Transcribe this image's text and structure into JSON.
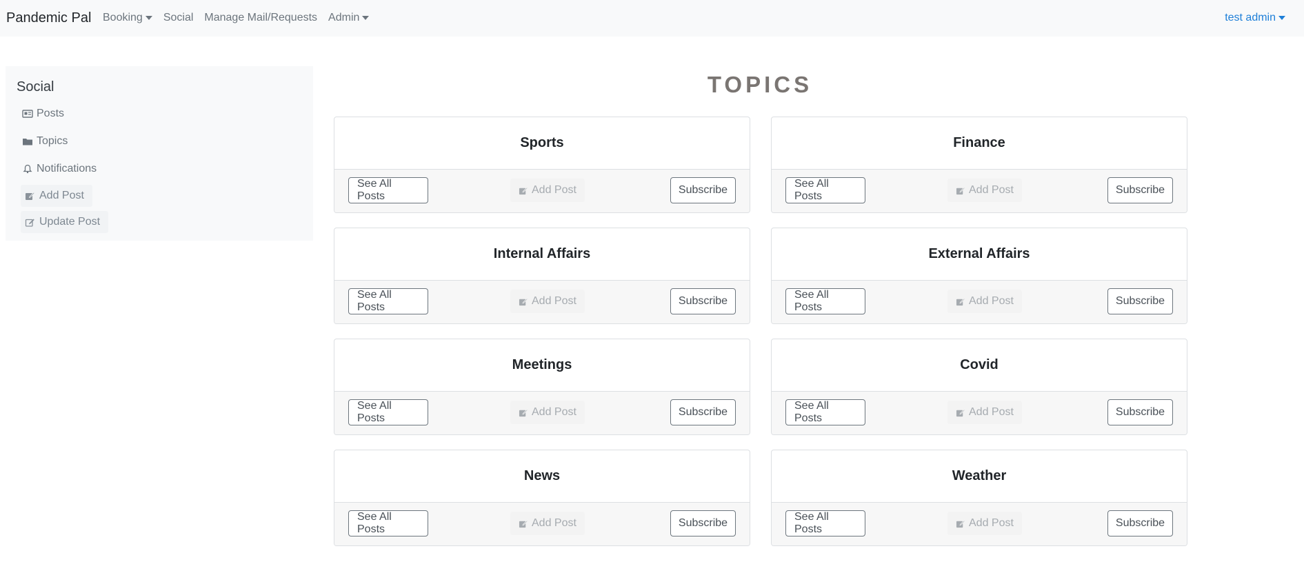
{
  "navbar": {
    "brand": "Pandemic Pal",
    "links": [
      {
        "label": "Booking",
        "dropdown": true
      },
      {
        "label": "Social",
        "dropdown": false
      },
      {
        "label": "Manage Mail/Requests",
        "dropdown": false
      },
      {
        "label": "Admin",
        "dropdown": true
      }
    ],
    "user": "test admin"
  },
  "sidebar": {
    "title": "Social",
    "items": [
      {
        "label": "Posts",
        "icon": "newspaper-icon"
      },
      {
        "label": "Topics",
        "icon": "folder-icon"
      },
      {
        "label": "Notifications",
        "icon": "bell-icon"
      }
    ],
    "actions": [
      {
        "label": "Add Post",
        "icon": "edit-icon"
      },
      {
        "label": "Update Post",
        "icon": "edit-icon"
      }
    ]
  },
  "main": {
    "title": "TOPICS",
    "button_labels": {
      "see_all": "See All Posts",
      "add_post": "Add Post",
      "subscribe": "Subscribe"
    },
    "topics": [
      {
        "name": "Sports"
      },
      {
        "name": "Finance"
      },
      {
        "name": "Internal Affairs"
      },
      {
        "name": "External Affairs"
      },
      {
        "name": "Meetings"
      },
      {
        "name": "Covid"
      },
      {
        "name": "News"
      },
      {
        "name": "Weather"
      }
    ]
  },
  "colors": {
    "navbar_bg": "#f8f9fa",
    "link_muted": "#6c757d",
    "user_link": "#1e7fd8",
    "title": "#7a7572"
  }
}
